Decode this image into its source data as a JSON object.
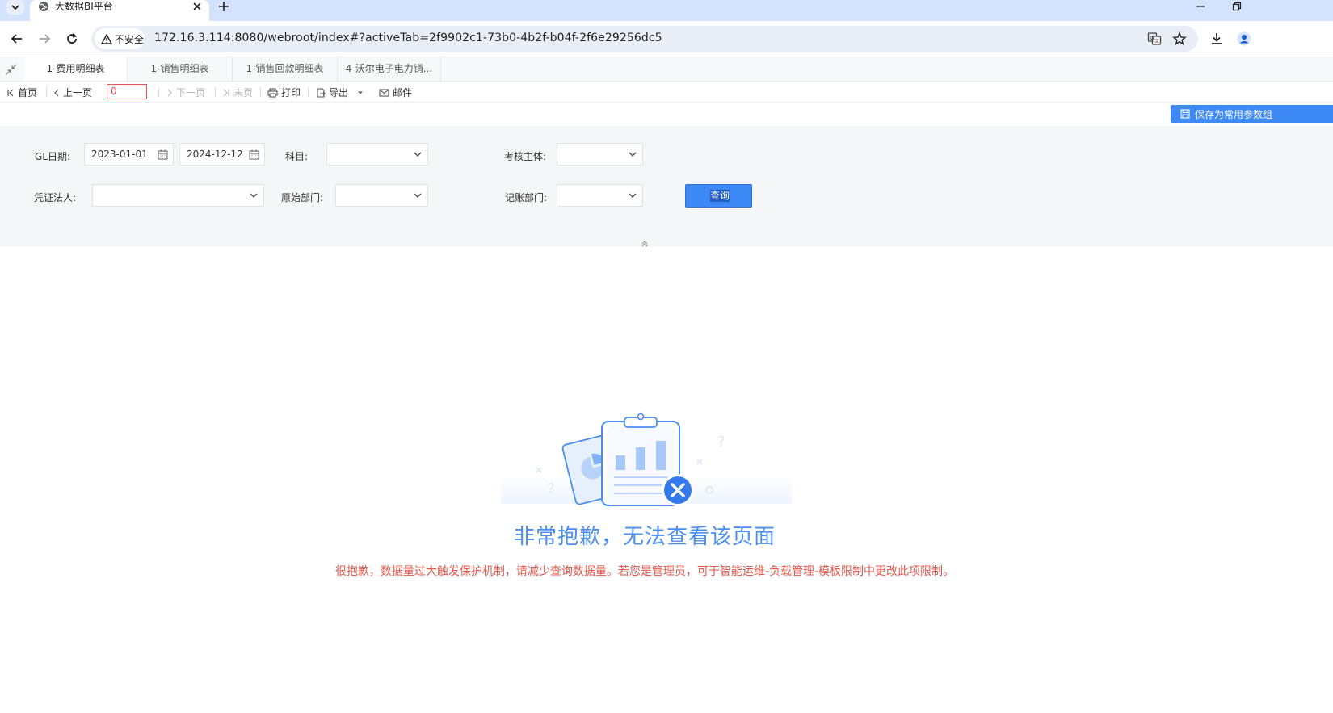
{
  "browser": {
    "tab_title": "大数据BI平台",
    "url": "172.16.3.114:8080/webroot/index#?activeTab=2f9902c1-73b0-4b2f-b04f-2f6e29256dc5",
    "security_label": "不安全"
  },
  "app_tabs": [
    {
      "label": "1-费用明细表",
      "active": true
    },
    {
      "label": "1-销售明细表",
      "active": false
    },
    {
      "label": "1-销售回款明细表",
      "active": false
    },
    {
      "label": "4-沃尔电子电力销...",
      "active": false
    }
  ],
  "report_toolbar": {
    "first": "首页",
    "prev": "上一页",
    "page_value": "0",
    "next": "下一页",
    "last": "末页",
    "print": "打印",
    "export": "导出",
    "mail": "邮件"
  },
  "save_params_label": "保存为常用参数组",
  "params": {
    "gl_date_label": "GL日期:",
    "gl_date_start": "2023-01-01",
    "gl_date_end": "2024-12-12",
    "subject_label": "科目:",
    "subject_value": "",
    "entity_label": "考核主体:",
    "entity_value": "",
    "voucher_label": "凭证法人:",
    "voucher_value": "",
    "origin_dept_label": "原始部门:",
    "origin_dept_value": "",
    "account_dept_label": "记账部门:",
    "account_dept_value": "",
    "query_label": "查询"
  },
  "error": {
    "title": "非常抱歉，无法查看该页面",
    "message": "很抱歉，数据量过大触发保护机制，请减少查询数据量。若您是管理员，可于智能运维-负载管理-模板限制中更改此项限制。"
  },
  "colors": {
    "accent": "#3d8af7",
    "error_title": "#4a8ef2",
    "error_message": "#e4564a"
  }
}
